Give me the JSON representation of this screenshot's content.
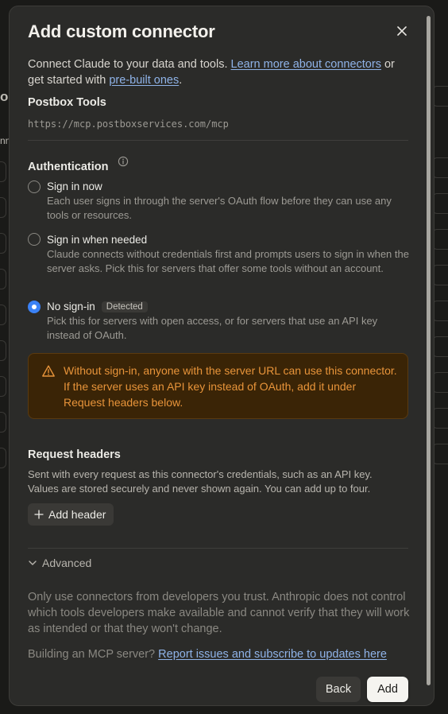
{
  "dialog": {
    "title": "Add custom connector",
    "intro_prefix": "Connect Claude to your data and tools. ",
    "learn_more_link": "Learn more about connectors",
    "intro_middle": " or get started with ",
    "prebuilt_link": "pre-built ones",
    "intro_suffix": ".",
    "server_name": "Postbox Tools",
    "server_url": "https://mcp.postboxservices.com/mcp"
  },
  "auth": {
    "label": "Authentication",
    "options": [
      {
        "label": "Sign in now",
        "desc": "Each user signs in through the server's OAuth flow before they can use any tools or resources.",
        "checked": false
      },
      {
        "label": "Sign in when needed",
        "desc": "Claude connects without credentials first and prompts users to sign in when the server asks. Pick this for servers that offer some tools without an account.",
        "checked": false
      },
      {
        "label": "No sign-in",
        "badge": "Detected",
        "desc": "Pick this for servers with open access, or for servers that use an API key instead of OAuth.",
        "checked": true
      }
    ],
    "warning": "Without sign-in, anyone with the server URL can use this connector. If the server uses an API key instead of OAuth, add it under Request headers below."
  },
  "headers": {
    "title": "Request headers",
    "desc": "Sent with every request as this connector's credentials, such as an API key. Values are stored securely and never shown again. You can add up to four.",
    "add_label": "Add header"
  },
  "advanced": {
    "label": "Advanced"
  },
  "footer": {
    "trust_text": "Only use connectors from developers you trust. Anthropic does not control which tools developers make available and cannot verify that they will work as intended or that they won't change.",
    "building_prefix": "Building an MCP server? ",
    "report_link": "Report issues and subscribe to updates here",
    "back_label": "Back",
    "add_label": "Add"
  },
  "background": {
    "fragment_1": "o",
    "fragment_2": "nn"
  },
  "colors": {
    "accent": "#3b82f6",
    "link": "#8fb3e8",
    "warning_text": "#e8943a",
    "warning_bg": "#3a2406"
  },
  "icons": [
    "close-icon",
    "info-icon",
    "warning-icon",
    "plus-icon",
    "chevron-down-icon"
  ]
}
